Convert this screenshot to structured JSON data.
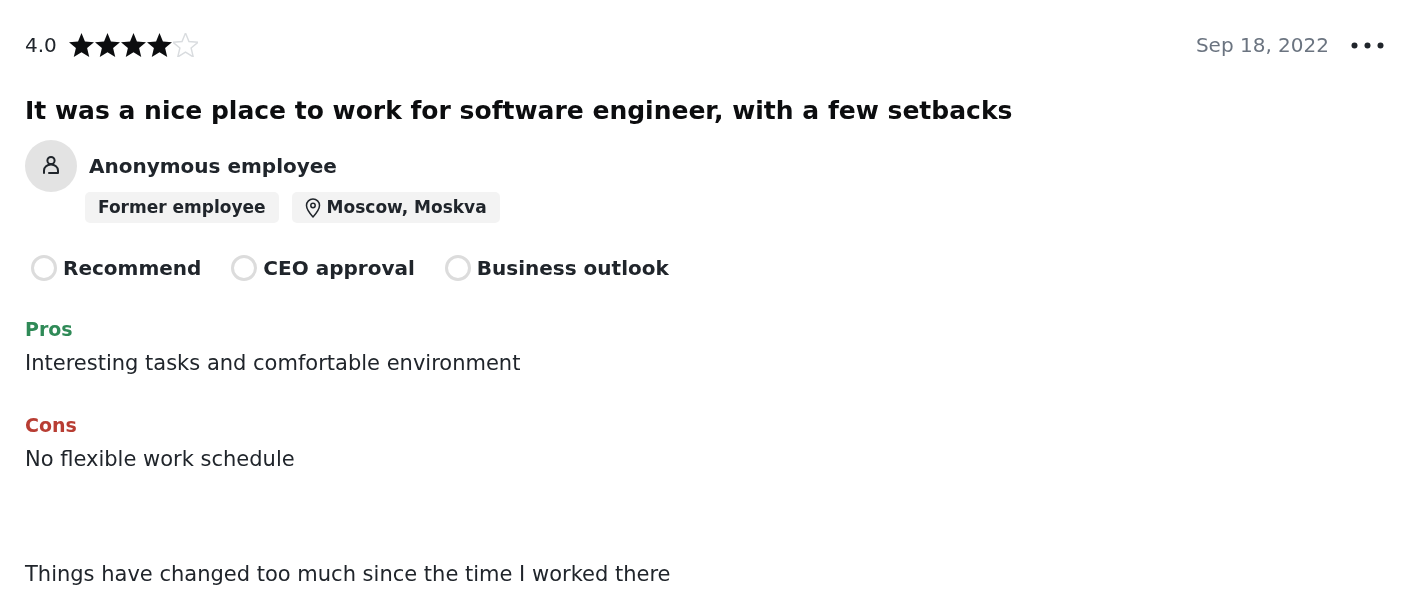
{
  "review": {
    "rating": "4.0",
    "stars": 4,
    "date": "Sep 18, 2022",
    "title": "It was a nice place to work for software engineer, with a few setbacks",
    "author": "Anonymous employee",
    "tags": [
      {
        "kind": "status",
        "label": "Former employee"
      },
      {
        "kind": "location",
        "label": "Moscow, Moskva"
      }
    ],
    "sentiments": [
      {
        "kind": "neutral",
        "label": "Recommend"
      },
      {
        "kind": "neutral",
        "label": "CEO approval"
      },
      {
        "kind": "neutral",
        "label": "Business outlook"
      }
    ],
    "sections": [
      {
        "heading": "Pros",
        "color": "#2f8a57",
        "text": "Interesting tasks and comfortable environment"
      },
      {
        "heading": "Cons",
        "color": "#b83d33",
        "text": "No flexible work schedule"
      }
    ],
    "closing_text": "Things have changed too much since the time I worked there"
  }
}
